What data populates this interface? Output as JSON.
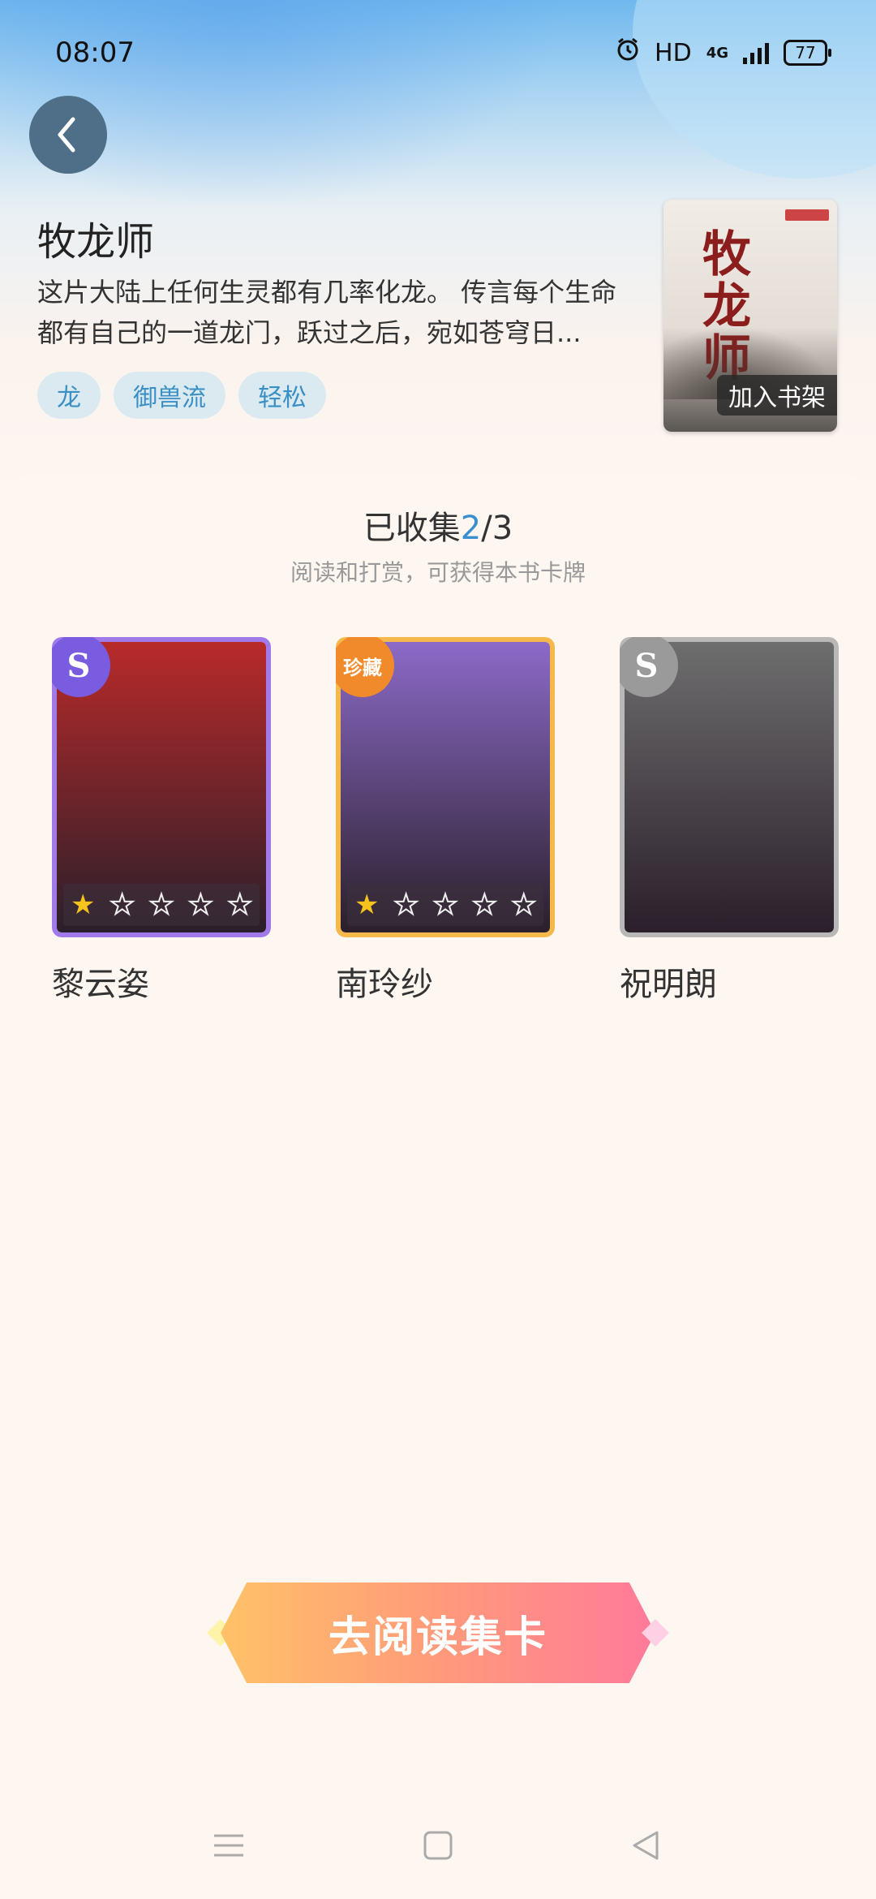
{
  "status_bar": {
    "time": "08:07",
    "hd_label": "HD",
    "network": "4G",
    "battery": "77"
  },
  "book": {
    "title": "牧龙师",
    "description": "这片大陆上任何生灵都有几率化龙。 传言每个生命都有自己的一道龙门，跃过之后，宛如苍穹日...",
    "tags": [
      "龙",
      "御兽流",
      "轻松"
    ],
    "cover_title": "牧龙师",
    "add_to_shelf": "加入书架"
  },
  "collection": {
    "label": "已收集",
    "collected": "2",
    "separator": "/",
    "total": "3",
    "hint": "阅读和打赏，可获得本书卡牌"
  },
  "cards": [
    {
      "name": "黎云姿",
      "badge": "S",
      "stars_filled": 1,
      "stars_total": 5,
      "owned": true,
      "badge_color": "#7a5ce0",
      "frame_color": "#a07ae8",
      "portrait_color": "#b92a2a"
    },
    {
      "name": "南玲纱",
      "badge": "珍藏",
      "stars_filled": 1,
      "stars_total": 5,
      "owned": true,
      "badge_color": "#f08a2a",
      "frame_color": "#f5b84a",
      "portrait_color": "#8c6ac8"
    },
    {
      "name": "祝明朗",
      "badge": "S",
      "stars_filled": 0,
      "stars_total": 5,
      "owned": false,
      "badge_color": "#9a9a9a",
      "frame_color": "#b8b8b8",
      "portrait_color": "#6e6e6e"
    }
  ],
  "cta": {
    "label": "去阅读集卡"
  },
  "nav": {
    "icons": [
      "menu-icon",
      "home-icon",
      "back-icon"
    ]
  }
}
